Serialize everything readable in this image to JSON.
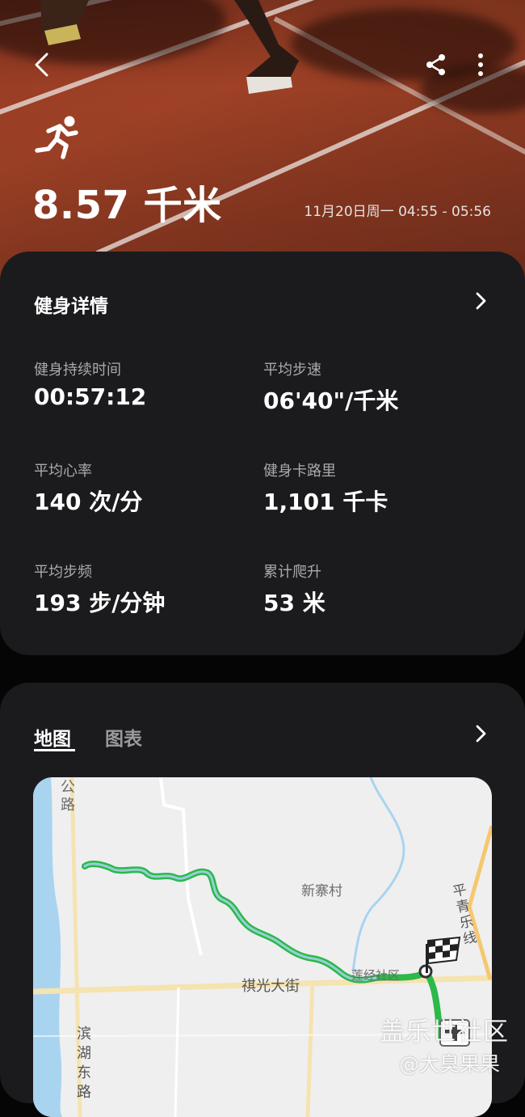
{
  "header": {
    "distance": "8.57 千米",
    "time_range": "11月20日周一 04:55 - 05:56",
    "icons": {
      "back": "back-arrow-icon",
      "share": "share-icon",
      "more": "more-vert-icon",
      "activity": "running-icon"
    }
  },
  "details": {
    "title": "健身详情",
    "stats": [
      {
        "label": "健身持续时间",
        "value": "00:57:12"
      },
      {
        "label": "平均步速",
        "value": "06'40\"/千米"
      },
      {
        "label": "平均心率",
        "value": "140 次/分"
      },
      {
        "label": "健身卡路里",
        "value": "1,101 千卡"
      },
      {
        "label": "平均步频",
        "value": "193 步/分钟"
      },
      {
        "label": "累计爬升",
        "value": "53 米"
      }
    ]
  },
  "map_card": {
    "tabs": [
      {
        "label": "地图",
        "active": true
      },
      {
        "label": "图表",
        "active": false
      }
    ],
    "map_labels": {
      "road_top": "公路",
      "village": "新寨村",
      "street": "祺光大街",
      "community": "莲经社区",
      "line": "平青乐线",
      "road_left": "滨湖东路"
    },
    "route_color": "#2db84a",
    "water_color": "#a8d4f0"
  },
  "watermark": {
    "line1": "盖乐世社区",
    "line2": "@大臭果果"
  }
}
